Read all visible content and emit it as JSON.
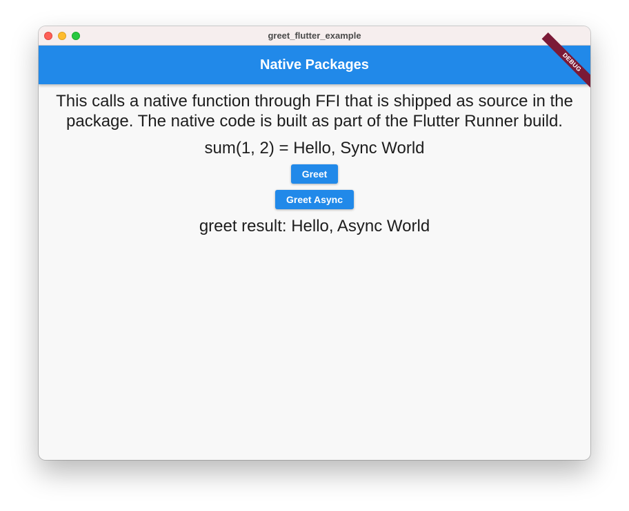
{
  "window": {
    "title": "greet_flutter_example"
  },
  "appbar": {
    "title": "Native Packages",
    "debug_banner": "DEBUG"
  },
  "content": {
    "description": "This calls a native function through FFI that is shipped as source in the package. The native code is built as part of the Flutter Runner build.",
    "sum_text": "sum(1, 2) = Hello, Sync World",
    "greet_button": "Greet",
    "greet_async_button": "Greet Async",
    "greet_result": "greet result: Hello, Async World"
  },
  "colors": {
    "appbar": "#2189e9",
    "button": "#2189e9",
    "debug_banner": "#7b1a37",
    "background": "#f8f8f8"
  }
}
